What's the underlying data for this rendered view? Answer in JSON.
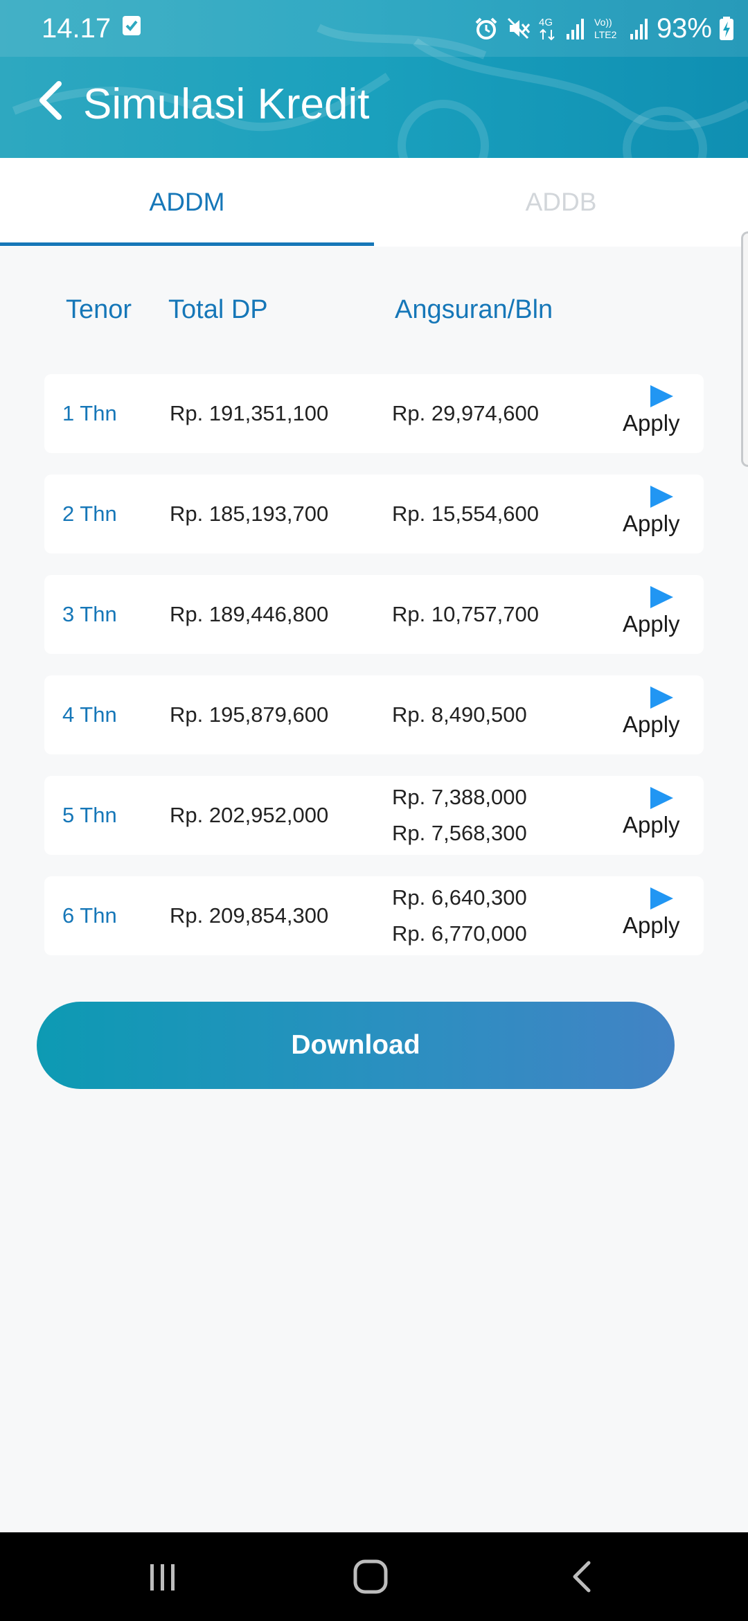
{
  "status_bar": {
    "time": "14.17",
    "battery": "93%",
    "network_4g": "4G",
    "network_volte": "Vo))",
    "network_lte2": "LTE2"
  },
  "app_bar": {
    "title": "Simulasi Kredit",
    "back_icon": "chevron-left-icon"
  },
  "tabs": [
    {
      "label": "ADDM",
      "active": true
    },
    {
      "label": "ADDB",
      "active": false
    }
  ],
  "columns": {
    "tenor": "Tenor",
    "total_dp": "Total DP",
    "angsuran": "Angsuran/Bln"
  },
  "rows": [
    {
      "tenor": "1 Thn",
      "total_dp": "Rp. 191,351,100",
      "angsuran": [
        "Rp. 29,974,600"
      ],
      "apply": "Apply"
    },
    {
      "tenor": "2 Thn",
      "total_dp": "Rp. 185,193,700",
      "angsuran": [
        "Rp. 15,554,600"
      ],
      "apply": "Apply"
    },
    {
      "tenor": "3 Thn",
      "total_dp": "Rp. 189,446,800",
      "angsuran": [
        "Rp. 10,757,700"
      ],
      "apply": "Apply"
    },
    {
      "tenor": "4 Thn",
      "total_dp": "Rp. 195,879,600",
      "angsuran": [
        "Rp. 8,490,500"
      ],
      "apply": "Apply"
    },
    {
      "tenor": "5 Thn",
      "total_dp": "Rp. 202,952,000",
      "angsuran": [
        "Rp. 7,388,000",
        "Rp. 7,568,300"
      ],
      "apply": "Apply"
    },
    {
      "tenor": "6 Thn",
      "total_dp": "Rp. 209,854,300",
      "angsuran": [
        "Rp. 6,640,300",
        "Rp. 6,770,000"
      ],
      "apply": "Apply"
    }
  ],
  "download_label": "Download",
  "colors": {
    "primary": "#1677b8",
    "header": "#1aa0bd",
    "apply_icon": "#2196f3"
  },
  "icons": {
    "apply": "play-arrow-icon",
    "nav_recent": "recent-apps-icon",
    "nav_home": "home-icon",
    "nav_back": "back-icon"
  }
}
